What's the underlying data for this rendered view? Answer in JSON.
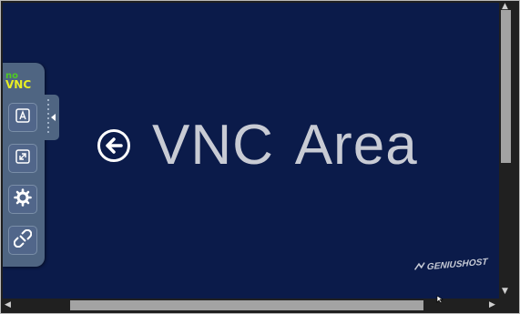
{
  "vnc_area": {
    "title": "VNC  Area",
    "brand": "GENIUSHOST",
    "background_color": "#0b1b4a"
  },
  "control_bar": {
    "logo_top": "no",
    "logo_bottom": "VNC",
    "buttons": [
      {
        "name": "extra-keys",
        "icon": "keyboard-a-icon"
      },
      {
        "name": "fullscreen",
        "icon": "fullscreen-icon"
      },
      {
        "name": "settings",
        "icon": "gear-icon"
      },
      {
        "name": "disconnect",
        "icon": "disconnect-icon"
      }
    ],
    "color": "#4f6582"
  },
  "scrollbars": {
    "vertical_position": 0.0,
    "horizontal_position": 0.15
  }
}
